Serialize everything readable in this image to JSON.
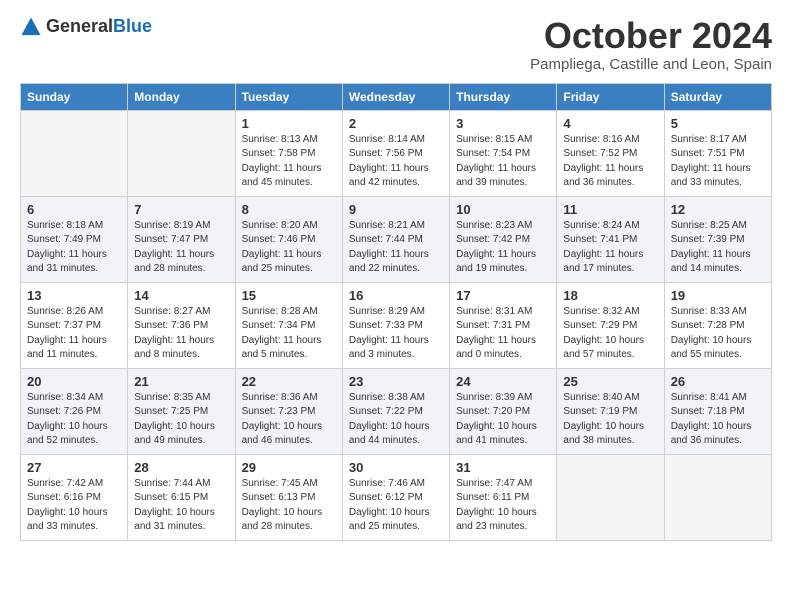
{
  "logo": {
    "text_general": "General",
    "text_blue": "Blue"
  },
  "header": {
    "month": "October 2024",
    "location": "Pampliega, Castille and Leon, Spain"
  },
  "weekdays": [
    "Sunday",
    "Monday",
    "Tuesday",
    "Wednesday",
    "Thursday",
    "Friday",
    "Saturday"
  ],
  "weeks": [
    [
      {
        "day": "",
        "sunrise": "",
        "sunset": "",
        "daylight": "",
        "empty": true
      },
      {
        "day": "",
        "sunrise": "",
        "sunset": "",
        "daylight": "",
        "empty": true
      },
      {
        "day": "1",
        "sunrise": "Sunrise: 8:13 AM",
        "sunset": "Sunset: 7:58 PM",
        "daylight": "Daylight: 11 hours and 45 minutes.",
        "empty": false
      },
      {
        "day": "2",
        "sunrise": "Sunrise: 8:14 AM",
        "sunset": "Sunset: 7:56 PM",
        "daylight": "Daylight: 11 hours and 42 minutes.",
        "empty": false
      },
      {
        "day": "3",
        "sunrise": "Sunrise: 8:15 AM",
        "sunset": "Sunset: 7:54 PM",
        "daylight": "Daylight: 11 hours and 39 minutes.",
        "empty": false
      },
      {
        "day": "4",
        "sunrise": "Sunrise: 8:16 AM",
        "sunset": "Sunset: 7:52 PM",
        "daylight": "Daylight: 11 hours and 36 minutes.",
        "empty": false
      },
      {
        "day": "5",
        "sunrise": "Sunrise: 8:17 AM",
        "sunset": "Sunset: 7:51 PM",
        "daylight": "Daylight: 11 hours and 33 minutes.",
        "empty": false
      }
    ],
    [
      {
        "day": "6",
        "sunrise": "Sunrise: 8:18 AM",
        "sunset": "Sunset: 7:49 PM",
        "daylight": "Daylight: 11 hours and 31 minutes.",
        "empty": false
      },
      {
        "day": "7",
        "sunrise": "Sunrise: 8:19 AM",
        "sunset": "Sunset: 7:47 PM",
        "daylight": "Daylight: 11 hours and 28 minutes.",
        "empty": false
      },
      {
        "day": "8",
        "sunrise": "Sunrise: 8:20 AM",
        "sunset": "Sunset: 7:46 PM",
        "daylight": "Daylight: 11 hours and 25 minutes.",
        "empty": false
      },
      {
        "day": "9",
        "sunrise": "Sunrise: 8:21 AM",
        "sunset": "Sunset: 7:44 PM",
        "daylight": "Daylight: 11 hours and 22 minutes.",
        "empty": false
      },
      {
        "day": "10",
        "sunrise": "Sunrise: 8:23 AM",
        "sunset": "Sunset: 7:42 PM",
        "daylight": "Daylight: 11 hours and 19 minutes.",
        "empty": false
      },
      {
        "day": "11",
        "sunrise": "Sunrise: 8:24 AM",
        "sunset": "Sunset: 7:41 PM",
        "daylight": "Daylight: 11 hours and 17 minutes.",
        "empty": false
      },
      {
        "day": "12",
        "sunrise": "Sunrise: 8:25 AM",
        "sunset": "Sunset: 7:39 PM",
        "daylight": "Daylight: 11 hours and 14 minutes.",
        "empty": false
      }
    ],
    [
      {
        "day": "13",
        "sunrise": "Sunrise: 8:26 AM",
        "sunset": "Sunset: 7:37 PM",
        "daylight": "Daylight: 11 hours and 11 minutes.",
        "empty": false
      },
      {
        "day": "14",
        "sunrise": "Sunrise: 8:27 AM",
        "sunset": "Sunset: 7:36 PM",
        "daylight": "Daylight: 11 hours and 8 minutes.",
        "empty": false
      },
      {
        "day": "15",
        "sunrise": "Sunrise: 8:28 AM",
        "sunset": "Sunset: 7:34 PM",
        "daylight": "Daylight: 11 hours and 5 minutes.",
        "empty": false
      },
      {
        "day": "16",
        "sunrise": "Sunrise: 8:29 AM",
        "sunset": "Sunset: 7:33 PM",
        "daylight": "Daylight: 11 hours and 3 minutes.",
        "empty": false
      },
      {
        "day": "17",
        "sunrise": "Sunrise: 8:31 AM",
        "sunset": "Sunset: 7:31 PM",
        "daylight": "Daylight: 11 hours and 0 minutes.",
        "empty": false
      },
      {
        "day": "18",
        "sunrise": "Sunrise: 8:32 AM",
        "sunset": "Sunset: 7:29 PM",
        "daylight": "Daylight: 10 hours and 57 minutes.",
        "empty": false
      },
      {
        "day": "19",
        "sunrise": "Sunrise: 8:33 AM",
        "sunset": "Sunset: 7:28 PM",
        "daylight": "Daylight: 10 hours and 55 minutes.",
        "empty": false
      }
    ],
    [
      {
        "day": "20",
        "sunrise": "Sunrise: 8:34 AM",
        "sunset": "Sunset: 7:26 PM",
        "daylight": "Daylight: 10 hours and 52 minutes.",
        "empty": false
      },
      {
        "day": "21",
        "sunrise": "Sunrise: 8:35 AM",
        "sunset": "Sunset: 7:25 PM",
        "daylight": "Daylight: 10 hours and 49 minutes.",
        "empty": false
      },
      {
        "day": "22",
        "sunrise": "Sunrise: 8:36 AM",
        "sunset": "Sunset: 7:23 PM",
        "daylight": "Daylight: 10 hours and 46 minutes.",
        "empty": false
      },
      {
        "day": "23",
        "sunrise": "Sunrise: 8:38 AM",
        "sunset": "Sunset: 7:22 PM",
        "daylight": "Daylight: 10 hours and 44 minutes.",
        "empty": false
      },
      {
        "day": "24",
        "sunrise": "Sunrise: 8:39 AM",
        "sunset": "Sunset: 7:20 PM",
        "daylight": "Daylight: 10 hours and 41 minutes.",
        "empty": false
      },
      {
        "day": "25",
        "sunrise": "Sunrise: 8:40 AM",
        "sunset": "Sunset: 7:19 PM",
        "daylight": "Daylight: 10 hours and 38 minutes.",
        "empty": false
      },
      {
        "day": "26",
        "sunrise": "Sunrise: 8:41 AM",
        "sunset": "Sunset: 7:18 PM",
        "daylight": "Daylight: 10 hours and 36 minutes.",
        "empty": false
      }
    ],
    [
      {
        "day": "27",
        "sunrise": "Sunrise: 7:42 AM",
        "sunset": "Sunset: 6:16 PM",
        "daylight": "Daylight: 10 hours and 33 minutes.",
        "empty": false
      },
      {
        "day": "28",
        "sunrise": "Sunrise: 7:44 AM",
        "sunset": "Sunset: 6:15 PM",
        "daylight": "Daylight: 10 hours and 31 minutes.",
        "empty": false
      },
      {
        "day": "29",
        "sunrise": "Sunrise: 7:45 AM",
        "sunset": "Sunset: 6:13 PM",
        "daylight": "Daylight: 10 hours and 28 minutes.",
        "empty": false
      },
      {
        "day": "30",
        "sunrise": "Sunrise: 7:46 AM",
        "sunset": "Sunset: 6:12 PM",
        "daylight": "Daylight: 10 hours and 25 minutes.",
        "empty": false
      },
      {
        "day": "31",
        "sunrise": "Sunrise: 7:47 AM",
        "sunset": "Sunset: 6:11 PM",
        "daylight": "Daylight: 10 hours and 23 minutes.",
        "empty": false
      },
      {
        "day": "",
        "sunrise": "",
        "sunset": "",
        "daylight": "",
        "empty": true
      },
      {
        "day": "",
        "sunrise": "",
        "sunset": "",
        "daylight": "",
        "empty": true
      }
    ]
  ]
}
